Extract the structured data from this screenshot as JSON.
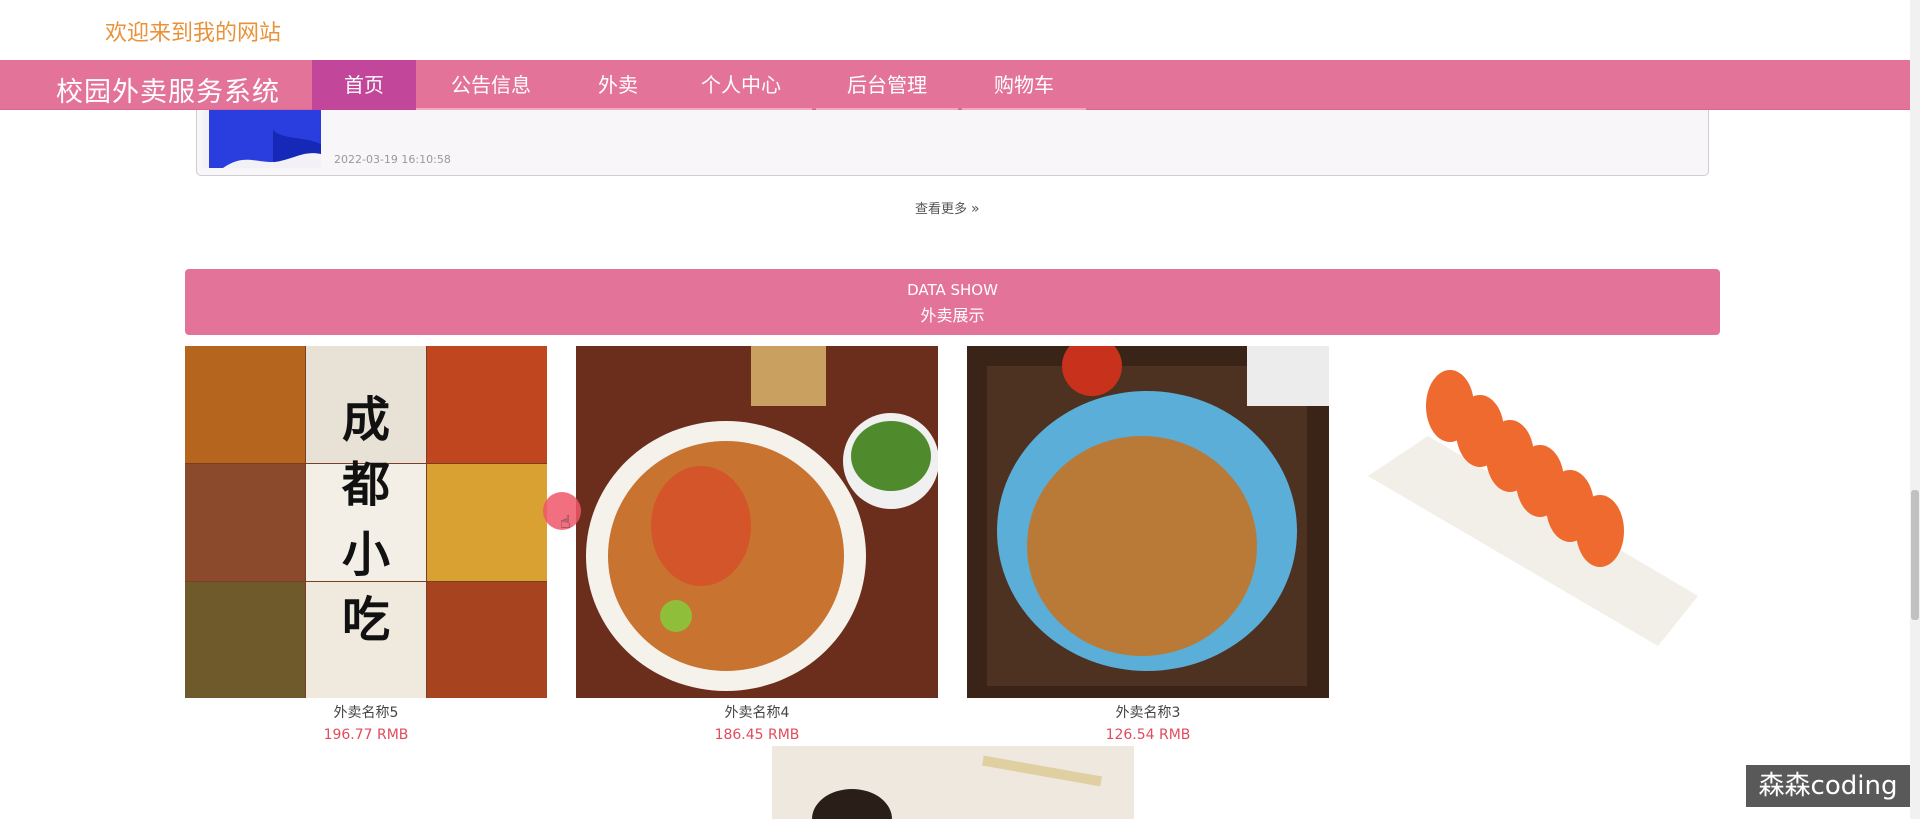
{
  "header": {
    "welcome": "欢迎来到我的网站"
  },
  "nav": {
    "brand": "校园外卖服务系统",
    "items": [
      {
        "label": "首页"
      },
      {
        "label": "公告信息"
      },
      {
        "label": "外卖"
      },
      {
        "label": "个人中心"
      },
      {
        "label": "后台管理"
      },
      {
        "label": "购物车"
      }
    ]
  },
  "news": {
    "date": "2022-03-19 16:10:58"
  },
  "more": {
    "label": "查看更多",
    "icon": "double-chevron-right-icon"
  },
  "section": {
    "title_en": "DATA SHOW",
    "title_zh": "外卖展示"
  },
  "products": [
    {
      "name": "外卖名称5",
      "price": "196.77 RMB",
      "image": "chengdu-snacks-collage"
    },
    {
      "name": "外卖名称4",
      "price": "186.45 RMB",
      "image": "seafood-platter"
    },
    {
      "name": "外卖名称3",
      "price": "126.54 RMB",
      "image": "beef-noodles"
    },
    {
      "name": "",
      "price": "",
      "image": "sushi-rolls"
    }
  ],
  "colors": {
    "accent": "#e4739a",
    "active": "#c2479a",
    "welcome": "#e8923a",
    "price": "#e24b5c"
  },
  "watermark": "森森coding"
}
